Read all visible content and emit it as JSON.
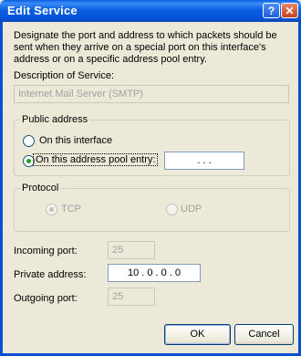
{
  "window": {
    "title": "Edit Service",
    "help_glyph": "?",
    "close_glyph": "✕"
  },
  "instructions": "Designate the port and address to which packets should be sent when they arrive on a special port on this interface's address or on a specific address pool entry.",
  "description": {
    "label": "Description of Service:",
    "value": "Internet Mail Server (SMTP)"
  },
  "public_address": {
    "legend": "Public address",
    "option_interface": "On this interface",
    "option_pool": "On this address pool entry:",
    "selected": "pool",
    "pool_value": ".   .   ."
  },
  "protocol": {
    "legend": "Protocol",
    "tcp": "TCP",
    "udp": "UDP",
    "selected": "TCP"
  },
  "incoming_port": {
    "label": "Incoming port:",
    "value": "25"
  },
  "private_address": {
    "label": "Private address:",
    "value": "10 . 0 . 0 . 0"
  },
  "outgoing_port": {
    "label": "Outgoing port:",
    "value": "25"
  },
  "buttons": {
    "ok": "OK",
    "cancel": "Cancel"
  },
  "colors": {
    "titlebar": "#0a5ee0",
    "face": "#ece9d8",
    "radio_dot": "#21a121"
  }
}
